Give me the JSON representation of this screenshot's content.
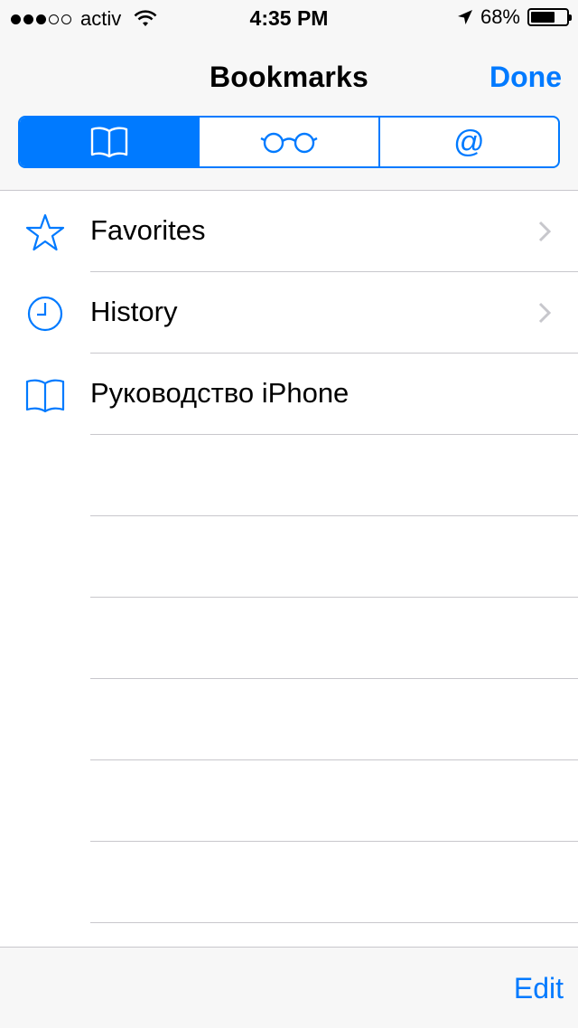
{
  "status_bar": {
    "signal_dots": [
      true,
      true,
      true,
      false,
      false
    ],
    "carrier": "activ",
    "time": "4:35 PM",
    "battery_percent": "68%",
    "battery_level": 0.68
  },
  "nav": {
    "title": "Bookmarks",
    "done_label": "Done"
  },
  "segments": [
    {
      "icon": "book-icon",
      "active": true
    },
    {
      "icon": "reading-glasses-icon",
      "active": false
    },
    {
      "icon": "at-sign-icon",
      "symbol": "@",
      "active": false
    }
  ],
  "list": {
    "items": [
      {
        "icon": "star-icon",
        "label": "Favorites",
        "has_chevron": true
      },
      {
        "icon": "clock-icon",
        "label": "History",
        "has_chevron": true
      },
      {
        "icon": "book-icon",
        "label": "Руководство iPhone",
        "has_chevron": false
      }
    ],
    "empty_rows": 6
  },
  "toolbar": {
    "edit_label": "Edit"
  },
  "colors": {
    "accent": "#007aff",
    "separator": "#c8c7cc",
    "bar_background": "#f7f7f7"
  }
}
